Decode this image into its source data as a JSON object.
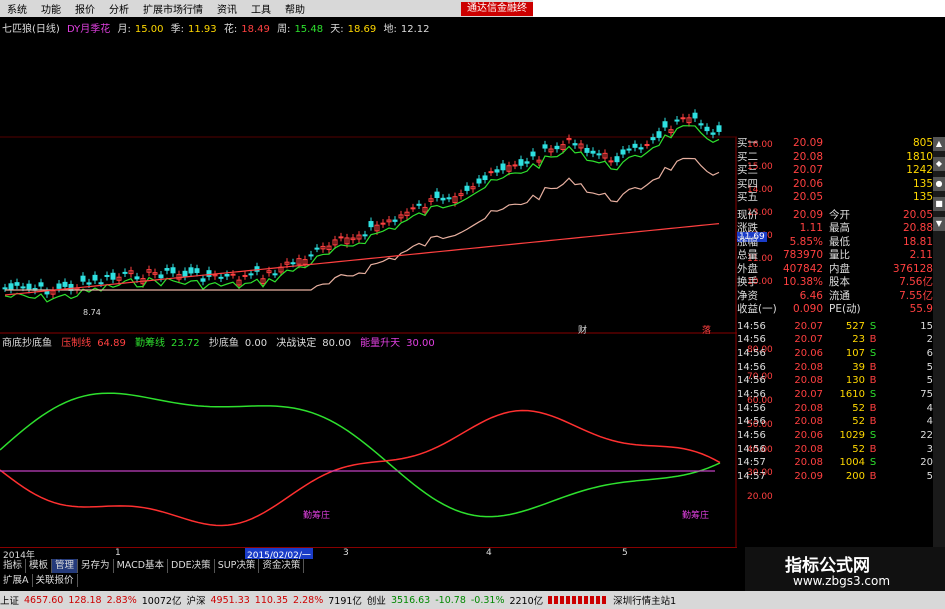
{
  "menu": {
    "items": [
      "系统",
      "功能",
      "报价",
      "分析",
      "扩展市场行情",
      "资讯",
      "工具",
      "帮助"
    ],
    "tip": "通达信金融终"
  },
  "title": {
    "name": "七匹狼(日线)",
    "ind": "DY月季花",
    "m_label": "月:",
    "m_val": "15.00",
    "j_label": "季:",
    "j_val": "11.93",
    "h_label": "花:",
    "h_val": "18.49",
    "z_label": "周:",
    "z_val": "15.48",
    "t_label": "天:",
    "t_val": "18.69",
    "d_label": "地:",
    "d_val": "12.12"
  },
  "price_axis": [
    "16.00",
    "15.00",
    "14.00",
    "13.00",
    "12.00",
    "11.00",
    "10.00"
  ],
  "current_price_tag": "11.69",
  "price_marks": {
    "left_low": "8.74",
    "wei": "财",
    "big": "落"
  },
  "indicator": {
    "name": "商底抄底鱼",
    "a_lab": "压制线",
    "a_val": "64.89",
    "b_lab": "勤筹线",
    "b_val": "23.72",
    "c_lab": "抄底鱼",
    "c_val": "0.00",
    "d_lab": "决战诀定",
    "d_val": "80.00",
    "e_lab": "能量升天",
    "e_val": "30.00"
  },
  "ind_axis": [
    "80.00",
    "70.00",
    "60.00",
    "50.00",
    "40.00",
    "30.00",
    "20.00"
  ],
  "ind_marks": [
    "勤筹庄",
    "勤筹庄"
  ],
  "quote": {
    "buy": [
      {
        "label": "买一",
        "price": "20.09",
        "vol": "805"
      },
      {
        "label": "买二",
        "price": "20.08",
        "vol": "1810"
      },
      {
        "label": "买三",
        "price": "20.07",
        "vol": "1242"
      },
      {
        "label": "买四",
        "price": "20.06",
        "vol": "135"
      },
      {
        "label": "买五",
        "price": "20.05",
        "vol": "135"
      }
    ],
    "stats": [
      {
        "l1": "现价",
        "v1": "20.09",
        "l2": "今开",
        "v2": "20.05"
      },
      {
        "l1": "涨跌",
        "v1": "1.11",
        "l2": "最高",
        "v2": "20.88"
      },
      {
        "l1": "涨幅",
        "v1": "5.85%",
        "l2": "最低",
        "v2": "18.81"
      },
      {
        "l1": "总量",
        "v1": "783970",
        "l2": "量比",
        "v2": "2.11"
      },
      {
        "l1": "外盘",
        "v1": "407842",
        "l2": "内盘",
        "v2": "376128"
      },
      {
        "l1": "换手",
        "v1": "10.38%",
        "l2": "股本",
        "v2": "7.56亿"
      },
      {
        "l1": "净资",
        "v1": "6.46",
        "l2": "流通",
        "v2": "7.55亿"
      },
      {
        "l1": "收益(一)",
        "v1": "0.090",
        "l2": "PE(动)",
        "v2": "55.9"
      }
    ],
    "ticks": [
      {
        "t": "14:56",
        "p": "20.07",
        "v": "527",
        "s": "S",
        "c": "15"
      },
      {
        "t": "14:56",
        "p": "20.07",
        "v": "23",
        "s": "B",
        "c": "2"
      },
      {
        "t": "14:56",
        "p": "20.06",
        "v": "107",
        "s": "S",
        "c": "6"
      },
      {
        "t": "14:56",
        "p": "20.08",
        "v": "39",
        "s": "B",
        "c": "5"
      },
      {
        "t": "14:56",
        "p": "20.08",
        "v": "130",
        "s": "B",
        "c": "5"
      },
      {
        "t": "14:56",
        "p": "20.07",
        "v": "1610",
        "s": "S",
        "c": "75"
      },
      {
        "t": "14:56",
        "p": "20.08",
        "v": "52",
        "s": "B",
        "c": "4"
      },
      {
        "t": "14:56",
        "p": "20.08",
        "v": "52",
        "s": "B",
        "c": "4"
      },
      {
        "t": "14:56",
        "p": "20.06",
        "v": "1029",
        "s": "S",
        "c": "22"
      },
      {
        "t": "14:56",
        "p": "20.08",
        "v": "52",
        "s": "B",
        "c": "3"
      },
      {
        "t": "14:57",
        "p": "20.08",
        "v": "1004",
        "s": "S",
        "c": "20"
      },
      {
        "t": "14:57",
        "p": "20.09",
        "v": "200",
        "s": "B",
        "c": "5"
      }
    ]
  },
  "dates": {
    "y": "2014年",
    "m1": "1",
    "sel": "2015/02/02/一",
    "m3": "3",
    "m4": "4",
    "m5": "5"
  },
  "tabs": [
    "指标",
    "模板",
    "管理",
    "另存为",
    "MACD基本",
    "DDE决策",
    "SUP决策",
    "资金决策"
  ],
  "subtabs": [
    "扩展A",
    "关联报价"
  ],
  "status": {
    "sh_lab": "上证",
    "sh": "4657.60",
    "sh_chg": "128.18",
    "sh_pct": "2.83%",
    "sh_amt": "10072亿",
    "sz_lab": "沪深",
    "sz": "4951.33",
    "sz_chg": "110.35",
    "sz_pct": "2.28%",
    "sz_amt": "7191亿",
    "cy_lab": "创业",
    "cy": "3516.63",
    "cy_chg": "-10.78",
    "cy_pct": "-0.31%",
    "cy_amt": "2210亿",
    "site": "深圳行情主站1"
  },
  "logo": {
    "line1": "指标公式网",
    "line2": "www.zbgs3.com"
  },
  "colors": {
    "up": "#ff4040",
    "down": "#2ee02e",
    "accent": "#ffd800",
    "magenta": "#e040e0"
  }
}
